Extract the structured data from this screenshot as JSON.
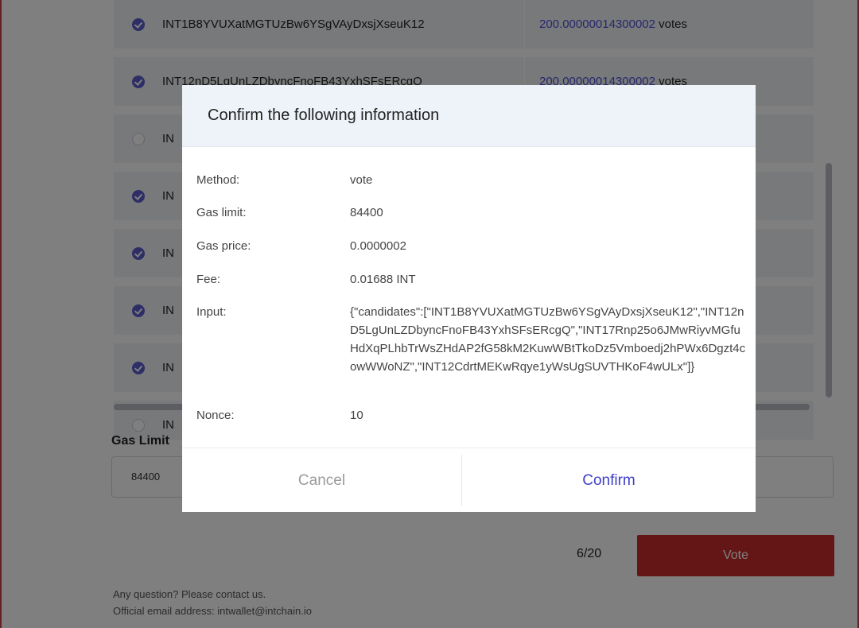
{
  "candidates": [
    {
      "selected": true,
      "address": "INT1B8YVUXatMGTUzBw6YSgVAyDxsjXseuK12",
      "votes_number": "200.00000014300002",
      "votes_unit": "votes"
    },
    {
      "selected": true,
      "address": "INT12nD5LgUnLZDbyncFnoFB43YxhSFsERcgQ",
      "votes_number": "200.00000014300002",
      "votes_unit": "votes"
    },
    {
      "selected": false,
      "address": "IN",
      "votes_number": "",
      "votes_unit": ""
    },
    {
      "selected": true,
      "address": "IN",
      "votes_number": "",
      "votes_unit": ""
    },
    {
      "selected": true,
      "address": "IN",
      "votes_number": "",
      "votes_unit": ""
    },
    {
      "selected": true,
      "address": "IN",
      "votes_number": "",
      "votes_unit": ""
    },
    {
      "selected": true,
      "address": "IN",
      "votes_number": "",
      "votes_unit": ""
    },
    {
      "selected": false,
      "address": "IN",
      "votes_number": "",
      "votes_unit": ""
    }
  ],
  "gas": {
    "label": "Gas Limit",
    "value": "84400"
  },
  "selection_counter": "6/20",
  "vote_button": "Vote",
  "footer": {
    "line1": "Any question? Please contact us.",
    "line2": "Official email address: intwallet@intchain.io"
  },
  "modal": {
    "title": "Confirm the following information",
    "fields": {
      "method_label": "Method:",
      "method_value": "vote",
      "gas_limit_label": "Gas limit:",
      "gas_limit_value": "84400",
      "gas_price_label": "Gas price:",
      "gas_price_value": "0.0000002",
      "fee_label": "Fee:",
      "fee_value": "0.01688 INT",
      "input_label": "Input:",
      "input_value": "{\"candidates\":[\"INT1B8YVUXatMGTUzBw6YSgVAyDxsjXseuK12\",\"INT12nD5LgUnLZDbyncFnoFB43YxhSFsERcgQ\",\"INT17Rnp25o6JMwRiyvMGfuHdXqPLhbTrWsZHdAP2fG58kM2KuwWBtTkoDz5Vmboedj2hPWx6Dgzt4cowWWoNZ\",\"INT12CdrtMEKwRqye1yWsUgSUVTHKoF4wULx\"]}",
      "nonce_label": "Nonce:",
      "nonce_value": "10"
    },
    "cancel": "Cancel",
    "confirm": "Confirm"
  },
  "colors": {
    "accent": "#4f4fd6",
    "vote_button": "#c82d2d",
    "overlay": "rgba(0,0,0,0.5)"
  }
}
